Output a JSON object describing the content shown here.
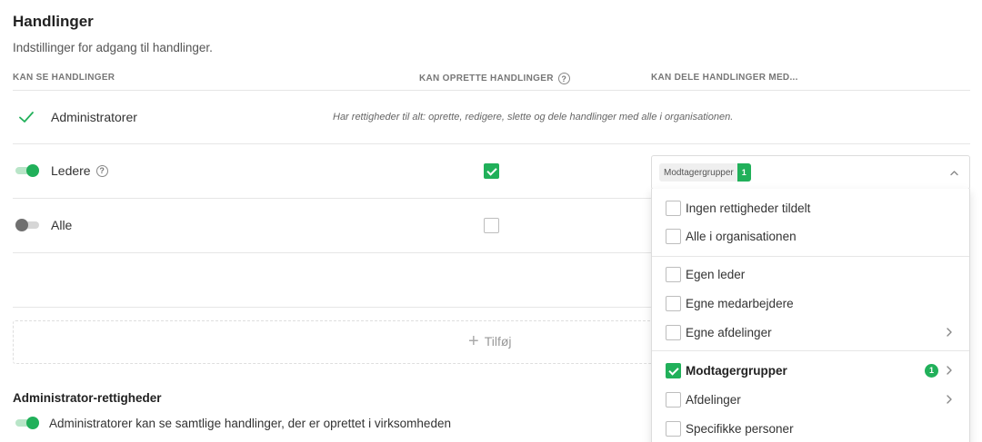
{
  "header": {
    "title": "Handlinger",
    "subtitle": "Indstillinger for adgang til handlinger."
  },
  "columns": {
    "can_see": "KAN SE HANDLINGER",
    "can_create": "KAN OPRETTE HANDLINGER",
    "can_share": "KAN DELE HANDLINGER MED..."
  },
  "help_glyph": "?",
  "rows": [
    {
      "label": "Administratorer",
      "indicator": "check-icon",
      "note": "Har rettigheder til alt: oprette, redigere, slette og dele handlinger med alle i organisationen."
    },
    {
      "label": "Ledere",
      "toggle_on": true,
      "can_create": true,
      "has_help": true
    },
    {
      "label": "Alle",
      "toggle_on": false,
      "can_create": false
    }
  ],
  "share_select": {
    "chip_label": "Modtagergrupper",
    "chip_count": "1",
    "expanded": true
  },
  "dropdown": {
    "group1": [
      {
        "label": "Ingen rettigheder tildelt",
        "checked": false
      },
      {
        "label": "Alle i organisationen",
        "checked": false
      }
    ],
    "group2": [
      {
        "label": "Egen leder",
        "checked": false
      },
      {
        "label": "Egne medarbejdere",
        "checked": false
      },
      {
        "label": "Egne afdelinger",
        "checked": false,
        "has_submenu": true
      }
    ],
    "group3": [
      {
        "label": "Modtagergrupper",
        "checked": true,
        "has_submenu": true,
        "badge": "1"
      },
      {
        "label": "Afdelinger",
        "checked": false,
        "has_submenu": true
      },
      {
        "label": "Specifikke personer",
        "checked": false
      }
    ]
  },
  "add_button": {
    "label": "Tilføj",
    "icon": "plus-icon"
  },
  "admin_rights": {
    "title": "Administrator-rettigheder",
    "setting_label": "Administratorer kan se samtlige handlinger, der er oprettet i virksomheden",
    "toggle_on": true
  },
  "colors": {
    "accent": "#21b05a",
    "accent_light": "#b9e5c8",
    "toggle_off": "#707070"
  }
}
